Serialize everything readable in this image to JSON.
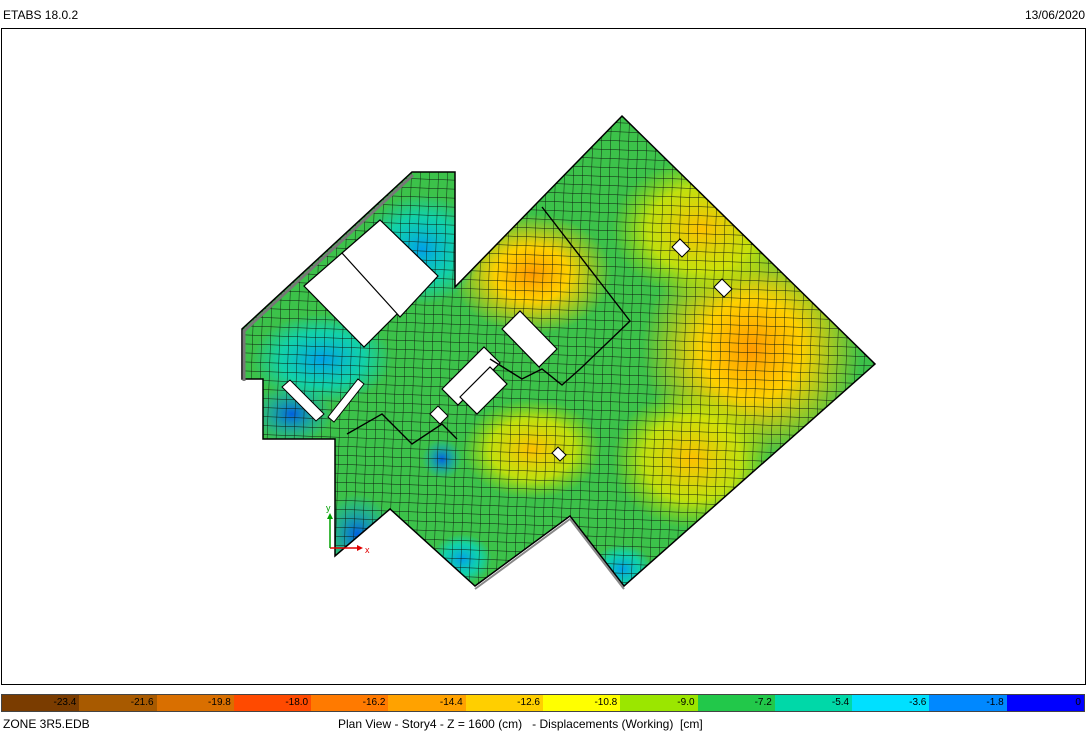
{
  "window": {
    "app_version": "ETABS 18.0.2",
    "date": "13/06/2020"
  },
  "footer": {
    "file_name": "ZONE 3R5.EDB",
    "caption": "Plan View - Story4 - Z = 1600 (cm)   - Displacements (Working)  [cm]"
  },
  "legend": {
    "unit": "cm",
    "segments": [
      {
        "label": "-23.4",
        "color": "#7a3c00"
      },
      {
        "label": "-21.6",
        "color": "#a85a00"
      },
      {
        "label": "-19.8",
        "color": "#d96f00"
      },
      {
        "label": "-18.0",
        "color": "#ff4a00"
      },
      {
        "label": "-16.2",
        "color": "#ff7a00"
      },
      {
        "label": "-14.4",
        "color": "#ffa200"
      },
      {
        "label": "-12.6",
        "color": "#ffcf00"
      },
      {
        "label": "-10.8",
        "color": "#ffff00"
      },
      {
        "label": "-9.0",
        "color": "#9be600"
      },
      {
        "label": "-7.2",
        "color": "#22c84a"
      },
      {
        "label": "-5.4",
        "color": "#00d8a8"
      },
      {
        "label": "-3.6",
        "color": "#00e0ff"
      },
      {
        "label": "-1.8",
        "color": "#0088ff"
      },
      {
        "label": "0",
        "color": "#0000ff"
      }
    ]
  },
  "axes": {
    "x_label": "x",
    "y_label": "y"
  },
  "colors": {
    "grid_line": "#101810",
    "slab_green": "#3cc24a",
    "edge": "#000000"
  }
}
